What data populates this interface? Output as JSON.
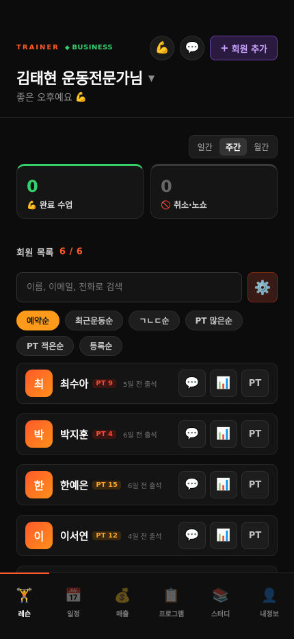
{
  "brand": {
    "trainer": "TRAINER",
    "diamond": "◆",
    "business": "BUSINESS"
  },
  "header": {
    "emoji_btn": "💪",
    "chat_btn": "💬",
    "add_member_plus": "+",
    "add_member_label": "회원 추가",
    "title": "김태현 운동전문가님",
    "caret": "▼",
    "greeting": "좋은 오후예요",
    "greeting_emoji": "💪"
  },
  "period": {
    "tabs": [
      "일간",
      "주간",
      "월간"
    ],
    "active": "주간"
  },
  "stats": {
    "done": {
      "value": "0",
      "icon": "💪",
      "label": "완료 수업"
    },
    "cancel": {
      "value": "0",
      "icon": "🚫",
      "label": "취소·노쇼"
    }
  },
  "members_section": {
    "title": "회원 목록",
    "count": "6 / 6"
  },
  "search": {
    "placeholder": "이름, 이메일, 전화로 검색",
    "value": "",
    "settings_icon": "⚙️"
  },
  "sort_chips": [
    "예약순",
    "최근운동순",
    "ㄱㄴㄷ순",
    "PT 많은순",
    "PT 적은순",
    "등록순"
  ],
  "sort_active": "예약순",
  "members": [
    {
      "initial": "최",
      "name": "최수아",
      "pt": "PT 9",
      "pt_tone": "red",
      "attend": "5일 전 출석"
    },
    {
      "initial": "박",
      "name": "박지훈",
      "pt": "PT 4",
      "pt_tone": "red",
      "attend": "6일 전 출석"
    },
    {
      "initial": "한",
      "name": "한예은",
      "pt": "PT 15",
      "pt_tone": "orange",
      "attend": "6일 전 출석"
    },
    {
      "initial": "이",
      "name": "이서연",
      "pt": "PT 12",
      "pt_tone": "orange",
      "attend": "4일 전 출석"
    }
  ],
  "member_actions": {
    "chat": "💬",
    "stats": "📊",
    "pt": "PT"
  },
  "tabbar": [
    {
      "icon": "🏋️",
      "label": "레슨",
      "active": true
    },
    {
      "icon": "📅",
      "label": "일정",
      "active": false
    },
    {
      "icon": "💰",
      "label": "매출",
      "active": false
    },
    {
      "icon": "📋",
      "label": "프로그램",
      "active": false
    },
    {
      "icon": "📚",
      "label": "스터디",
      "active": false
    },
    {
      "icon": "👤",
      "label": "내정보",
      "active": false
    }
  ],
  "colors": {
    "accent": "#ff5a2a",
    "success": "#35d06a",
    "purple": "#c9a2ff",
    "chip_active": "#ff9a1a"
  }
}
